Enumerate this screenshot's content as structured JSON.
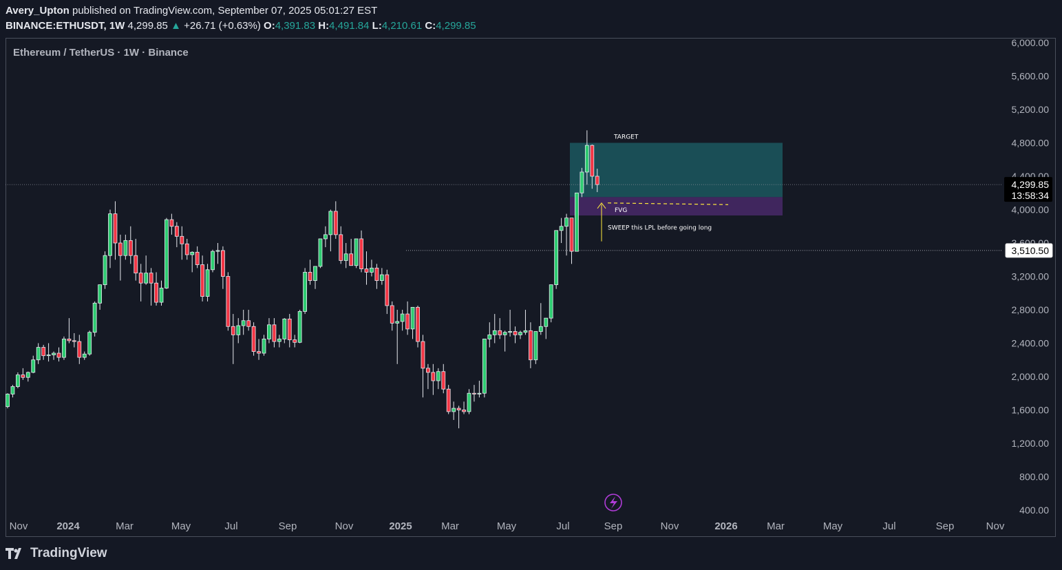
{
  "header": {
    "author": "Avery_Upton",
    "published": "published on TradingView.com, September 07, 2025 05:01:27 EST",
    "symbol": "BINANCE:ETHUSDT, 1W",
    "last": "4,299.85",
    "change": "+26.71 (+0.63%)",
    "o_label": "O:",
    "o": "4,391.83",
    "h_label": "H:",
    "h": "4,491.84",
    "l_label": "L:",
    "l": "4,210.61",
    "c_label": "C:",
    "c": "4,299.85"
  },
  "legend": "Ethereum / TetherUS · 1W · Binance",
  "brand": "TradingView",
  "icons": {
    "logo": "tradingview-logo-icon",
    "flash": "lightning-icon"
  },
  "colors": {
    "up": "#26a69a",
    "bull_fill": "#2ecc71",
    "bear": "#f23645",
    "target_zone": "#1f7a7f",
    "fvg_zone": "#5e2f86",
    "annotation": "#ffeb3b"
  },
  "chart_data": {
    "type": "candlestick",
    "interval": "1W",
    "ylim": [
      400,
      6000
    ],
    "yticks": [
      "6,000.00",
      "5,600.00",
      "5,200.00",
      "4,800.00",
      "4,400.00",
      "4,000.00",
      "3,600.00",
      "3,200.00",
      "2,800.00",
      "2,400.00",
      "2,000.00",
      "1,600.00",
      "1,200.00",
      "800.00",
      "400.00"
    ],
    "xticks": [
      "Nov",
      "2024",
      "Mar",
      "May",
      "Jul",
      "Sep",
      "Nov",
      "2025",
      "Mar",
      "May",
      "Jul",
      "Sep",
      "Nov",
      "2026",
      "Mar",
      "May",
      "Jul",
      "Sep",
      "Nov"
    ],
    "price_label": "4,299.85",
    "countdown": "13:58:34",
    "level_label": "3,510.50",
    "annotations": {
      "target": "TARGET",
      "fvg": "FVG",
      "note": "SWEEP this LPL before going long"
    },
    "ohlc": [
      [
        1640,
        1800,
        1620,
        1790
      ],
      [
        1790,
        1900,
        1750,
        1880
      ],
      [
        1880,
        2050,
        1860,
        2020
      ],
      [
        2020,
        2100,
        1960,
        1990
      ],
      [
        1990,
        2060,
        1940,
        2050
      ],
      [
        2050,
        2250,
        2040,
        2200
      ],
      [
        2200,
        2400,
        2150,
        2350
      ],
      [
        2350,
        2380,
        2200,
        2250
      ],
      [
        2250,
        2400,
        2180,
        2260
      ],
      [
        2260,
        2300,
        2200,
        2280
      ],
      [
        2280,
        2350,
        2180,
        2230
      ],
      [
        2230,
        2480,
        2200,
        2450
      ],
      [
        2450,
        2700,
        2400,
        2430
      ],
      [
        2430,
        2520,
        2350,
        2420
      ],
      [
        2420,
        2500,
        2150,
        2230
      ],
      [
        2230,
        2300,
        2200,
        2270
      ],
      [
        2270,
        2550,
        2250,
        2530
      ],
      [
        2530,
        2900,
        2480,
        2880
      ],
      [
        2880,
        3000,
        2800,
        3100
      ],
      [
        3100,
        3500,
        3050,
        3450
      ],
      [
        3450,
        4000,
        3300,
        3950
      ],
      [
        3950,
        4100,
        3400,
        3600
      ],
      [
        3600,
        3700,
        3150,
        3450
      ],
      [
        3450,
        3700,
        3400,
        3630
      ],
      [
        3630,
        3800,
        3350,
        3450
      ],
      [
        3450,
        3650,
        3150,
        3240
      ],
      [
        3240,
        3350,
        2900,
        3120
      ],
      [
        3120,
        3450,
        3100,
        3240
      ],
      [
        3240,
        3300,
        2850,
        3120
      ],
      [
        3120,
        3250,
        2850,
        2890
      ],
      [
        2890,
        3150,
        2850,
        3060
      ],
      [
        3060,
        3900,
        3050,
        3880
      ],
      [
        3880,
        3950,
        3700,
        3800
      ],
      [
        3800,
        3850,
        3550,
        3680
      ],
      [
        3680,
        3800,
        3400,
        3590
      ],
      [
        3590,
        3650,
        3400,
        3460
      ],
      [
        3460,
        3500,
        3250,
        3490
      ],
      [
        3490,
        3560,
        3300,
        3340
      ],
      [
        3340,
        3450,
        2900,
        2960
      ],
      [
        2960,
        3350,
        2900,
        3280
      ],
      [
        3280,
        3520,
        3250,
        3500
      ],
      [
        3500,
        3600,
        3350,
        3510
      ],
      [
        3510,
        3560,
        3050,
        3200
      ],
      [
        3200,
        3250,
        2550,
        2600
      ],
      [
        2600,
        2750,
        2150,
        2500
      ],
      [
        2500,
        2700,
        2400,
        2610
      ],
      [
        2610,
        2800,
        2500,
        2670
      ],
      [
        2670,
        2800,
        2550,
        2600
      ],
      [
        2600,
        2650,
        2250,
        2300
      ],
      [
        2300,
        2450,
        2200,
        2280
      ],
      [
        2280,
        2500,
        2250,
        2450
      ],
      [
        2450,
        2700,
        2400,
        2620
      ],
      [
        2620,
        2700,
        2350,
        2420
      ],
      [
        2420,
        2500,
        2350,
        2450
      ],
      [
        2450,
        2700,
        2400,
        2690
      ],
      [
        2690,
        2750,
        2350,
        2440
      ],
      [
        2440,
        2500,
        2350,
        2410
      ],
      [
        2410,
        2800,
        2400,
        2780
      ],
      [
        2780,
        3300,
        2750,
        3250
      ],
      [
        3250,
        3400,
        3100,
        3150
      ],
      [
        3150,
        3300,
        3050,
        3320
      ],
      [
        3320,
        3650,
        3300,
        3650
      ],
      [
        3650,
        3800,
        3550,
        3700
      ],
      [
        3700,
        4000,
        3500,
        3980
      ],
      [
        3980,
        4100,
        3650,
        3700
      ],
      [
        3700,
        3800,
        3350,
        3390
      ],
      [
        3390,
        3600,
        3300,
        3470
      ],
      [
        3470,
        3650,
        3350,
        3330
      ],
      [
        3330,
        3650,
        3300,
        3650
      ],
      [
        3650,
        3750,
        3250,
        3290
      ],
      [
        3290,
        3500,
        3100,
        3250
      ],
      [
        3250,
        3400,
        3200,
        3300
      ],
      [
        3300,
        3350,
        3050,
        3150
      ],
      [
        3150,
        3300,
        3100,
        3220
      ],
      [
        3220,
        3280,
        2750,
        2850
      ],
      [
        2850,
        2900,
        2550,
        2640
      ],
      [
        2640,
        2800,
        2150,
        2660
      ],
      [
        2660,
        2800,
        2550,
        2750
      ],
      [
        2750,
        2900,
        2500,
        2570
      ],
      [
        2570,
        2800,
        2450,
        2830
      ],
      [
        2830,
        2850,
        2350,
        2420
      ],
      [
        2420,
        2500,
        1750,
        2100
      ],
      [
        2100,
        2150,
        1850,
        2050
      ],
      [
        2050,
        2150,
        1780,
        1950
      ],
      [
        1950,
        2100,
        1850,
        2060
      ],
      [
        2060,
        2150,
        1800,
        1850
      ],
      [
        1850,
        1900,
        1550,
        1580
      ],
      [
        1580,
        1700,
        1480,
        1620
      ],
      [
        1620,
        1650,
        1380,
        1600
      ],
      [
        1600,
        1700,
        1550,
        1580
      ],
      [
        1580,
        1850,
        1550,
        1800
      ],
      [
        1800,
        1900,
        1700,
        1790
      ],
      [
        1790,
        1950,
        1750,
        1800
      ],
      [
        1800,
        2100,
        1750,
        2450
      ],
      [
        2450,
        2650,
        2350,
        2500
      ],
      [
        2500,
        2750,
        2400,
        2550
      ],
      [
        2550,
        2700,
        2450,
        2500
      ],
      [
        2500,
        2550,
        2300,
        2530
      ],
      [
        2530,
        2800,
        2480,
        2540
      ],
      [
        2540,
        2600,
        2400,
        2500
      ],
      [
        2500,
        2550,
        2450,
        2530
      ],
      [
        2530,
        2800,
        2500,
        2550
      ],
      [
        2550,
        2650,
        2100,
        2200
      ],
      [
        2200,
        2450,
        2150,
        2540
      ],
      [
        2540,
        2880,
        2500,
        2600
      ],
      [
        2600,
        2700,
        2450,
        2700
      ],
      [
        2700,
        3000,
        2650,
        3100
      ],
      [
        3100,
        3500,
        3050,
        3750
      ],
      [
        3750,
        3900,
        3600,
        3800
      ],
      [
        3800,
        3950,
        3450,
        3900
      ],
      [
        3900,
        3800,
        3350,
        3500
      ],
      [
        3500,
        4200,
        3500,
        4200
      ],
      [
        4200,
        4500,
        4150,
        4450
      ],
      [
        4450,
        4950,
        4300,
        4770
      ],
      [
        4770,
        4780,
        4250,
        4400
      ],
      [
        4400,
        4490,
        4210,
        4300
      ]
    ]
  }
}
